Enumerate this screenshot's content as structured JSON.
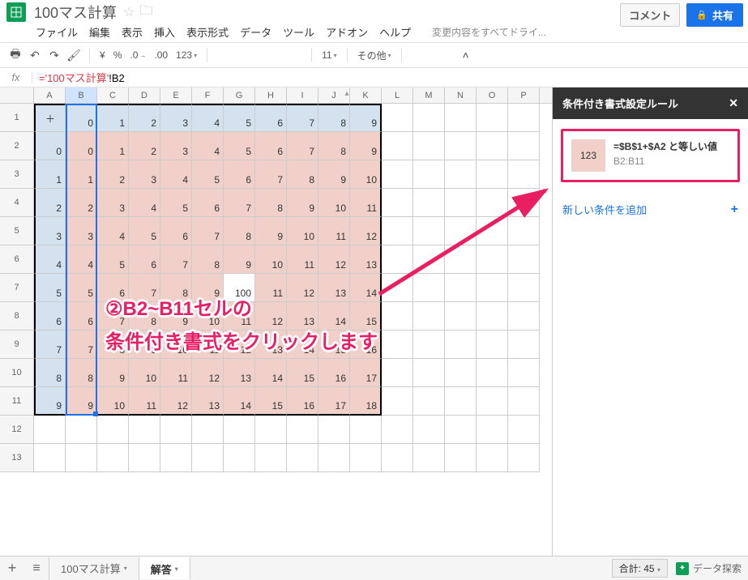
{
  "header": {
    "docTitle": "100マス計算",
    "commentLabel": "コメント",
    "shareLabel": "共有"
  },
  "menuBar": {
    "items": [
      "ファイル",
      "編集",
      "表示",
      "挿入",
      "表示形式",
      "データ",
      "ツール",
      "アドオン",
      "ヘルプ"
    ],
    "status": "変更内容をすべてドライ..."
  },
  "toolbar": {
    "currencySymbol": "¥",
    "percent": "%",
    "dec1": ".0",
    "dec2": ".00",
    "numFmt": "123",
    "fontSize": "11",
    "more": "その他"
  },
  "formulaBar": {
    "fxLabel": "fx",
    "sheetRef": "='100マス計算'",
    "cellRef": "!B2"
  },
  "gridCols": [
    "A",
    "B",
    "C",
    "D",
    "E",
    "F",
    "G",
    "H",
    "I",
    "J",
    "K",
    "L",
    "M",
    "N",
    "O",
    "P"
  ],
  "gridRows": [
    "1",
    "2",
    "3",
    "4",
    "5",
    "6",
    "7",
    "8",
    "9",
    "10",
    "11",
    "12",
    "13"
  ],
  "cells": {
    "r1": [
      "＋",
      "0",
      "1",
      "2",
      "3",
      "4",
      "5",
      "6",
      "7",
      "8",
      "9"
    ],
    "r2": [
      "0",
      "0",
      "1",
      "2",
      "3",
      "4",
      "5",
      "6",
      "7",
      "8",
      "9"
    ],
    "r3": [
      "1",
      "1",
      "2",
      "3",
      "4",
      "5",
      "6",
      "7",
      "8",
      "9",
      "10"
    ],
    "r4": [
      "2",
      "2",
      "3",
      "4",
      "5",
      "6",
      "7",
      "8",
      "9",
      "10",
      "11"
    ],
    "r5": [
      "3",
      "3",
      "4",
      "5",
      "6",
      "7",
      "8",
      "9",
      "10",
      "11",
      "12"
    ],
    "r6": [
      "4",
      "4",
      "5",
      "6",
      "7",
      "8",
      "9",
      "10",
      "11",
      "12",
      "13"
    ],
    "r7": [
      "5",
      "5",
      "6",
      "7",
      "8",
      "9",
      "100",
      "11",
      "12",
      "13",
      "14"
    ],
    "r8": [
      "6",
      "6",
      "7",
      "8",
      "9",
      "10",
      "11",
      "12",
      "13",
      "14",
      "15"
    ],
    "r9": [
      "7",
      "7",
      "8",
      "9",
      "10",
      "11",
      "12",
      "13",
      "14",
      "15",
      "16"
    ],
    "r10": [
      "8",
      "8",
      "9",
      "10",
      "11",
      "12",
      "13",
      "14",
      "15",
      "16",
      "17"
    ],
    "r11": [
      "9",
      "9",
      "10",
      "11",
      "12",
      "13",
      "14",
      "15",
      "16",
      "17",
      "18"
    ]
  },
  "panel": {
    "title": "条件付き書式設定ルール",
    "ruleSwatchText": "123",
    "ruleFormula": "=$B$1+$A2 と等しい値",
    "ruleRange": "B2:B11",
    "addRule": "新しい条件を追加"
  },
  "overlay": {
    "line1": "②B2~B11セルの",
    "line2": "条件付き書式をクリックします"
  },
  "footer": {
    "tab1": "100マス計算",
    "tab2": "解答",
    "sumLabel": "合計: 45",
    "explore": "データ探索"
  }
}
